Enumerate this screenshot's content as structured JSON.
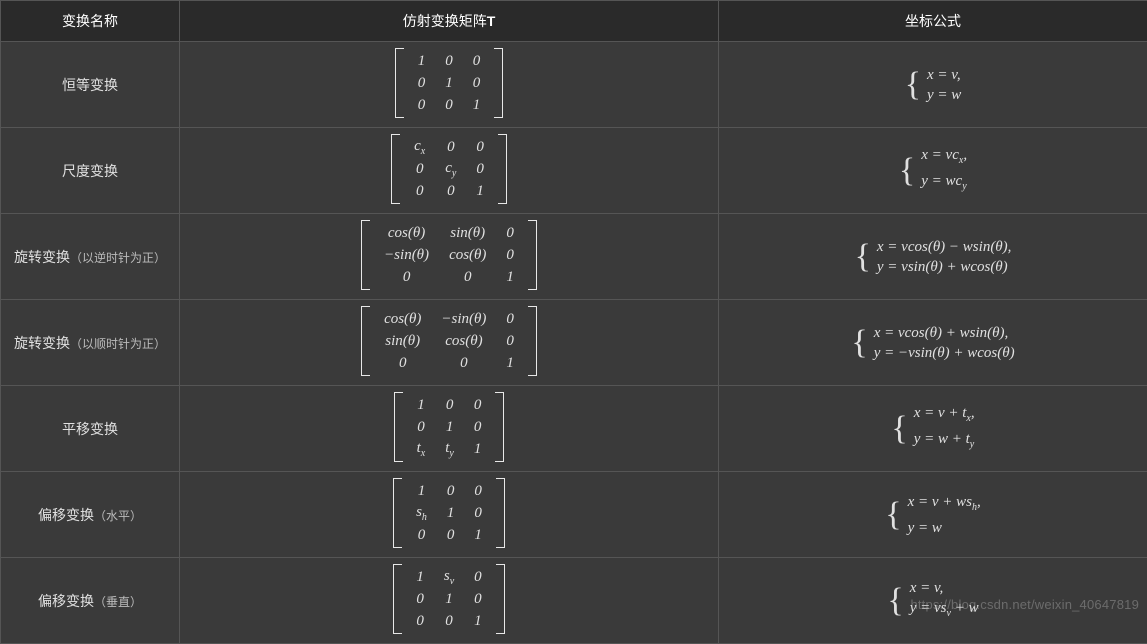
{
  "headers": {
    "name": "变换名称",
    "matrix_pre": "仿射变换矩阵",
    "matrix_T": "T",
    "formula": "坐标公式"
  },
  "rows": [
    {
      "name_main": "恒等变换",
      "name_sub": "",
      "matrix": [
        [
          "1",
          "0",
          "0"
        ],
        [
          "0",
          "1",
          "0"
        ],
        [
          "0",
          "0",
          "1"
        ]
      ],
      "formula": [
        "x = v,",
        "y = w"
      ]
    },
    {
      "name_main": "尺度变换",
      "name_sub": "",
      "matrix": [
        [
          "c<sub>x</sub>",
          "0",
          "0"
        ],
        [
          "0",
          "c<sub>y</sub>",
          "0"
        ],
        [
          "0",
          "0",
          "1"
        ]
      ],
      "formula": [
        "x = vc<sub>x</sub>,",
        "y = wc<sub>y</sub>"
      ]
    },
    {
      "name_main": "旋转变换",
      "name_sub": "（以逆时针为正）",
      "matrix": [
        [
          "cos(θ)",
          "sin(θ)",
          "0"
        ],
        [
          "−sin(θ)",
          "cos(θ)",
          "0"
        ],
        [
          "0",
          "0",
          "1"
        ]
      ],
      "formula": [
        "x = vcos(θ) − wsin(θ),",
        "y = vsin(θ) + wcos(θ)"
      ]
    },
    {
      "name_main": "旋转变换",
      "name_sub": "（以顺时针为正）",
      "matrix": [
        [
          "cos(θ)",
          "−sin(θ)",
          "0"
        ],
        [
          "sin(θ)",
          "cos(θ)",
          "0"
        ],
        [
          "0",
          "0",
          "1"
        ]
      ],
      "formula": [
        "x = vcos(θ) + wsin(θ),",
        "y = −vsin(θ) + wcos(θ)"
      ]
    },
    {
      "name_main": "平移变换",
      "name_sub": "",
      "matrix": [
        [
          "1",
          "0",
          "0"
        ],
        [
          "0",
          "1",
          "0"
        ],
        [
          "t<sub>x</sub>",
          "t<sub>y</sub>",
          "1"
        ]
      ],
      "formula": [
        "x = v + t<sub>x</sub>,",
        "y = w + t<sub>y</sub>"
      ]
    },
    {
      "name_main": "偏移变换",
      "name_sub": "（水平）",
      "matrix": [
        [
          "1",
          "0",
          "0"
        ],
        [
          "s<sub>h</sub>",
          "1",
          "0"
        ],
        [
          "0",
          "0",
          "1"
        ]
      ],
      "formula": [
        "x = v + ws<sub>h</sub>,",
        "y = w"
      ]
    },
    {
      "name_main": "偏移变换",
      "name_sub": "（垂直）",
      "matrix": [
        [
          "1",
          "s<sub>v</sub>",
          "0"
        ],
        [
          "0",
          "1",
          "0"
        ],
        [
          "0",
          "0",
          "1"
        ]
      ],
      "formula": [
        "x = v,",
        "y = vs<sub>v</sub> + w"
      ]
    }
  ],
  "watermark": "https://blog.csdn.net/weixin_40647819"
}
